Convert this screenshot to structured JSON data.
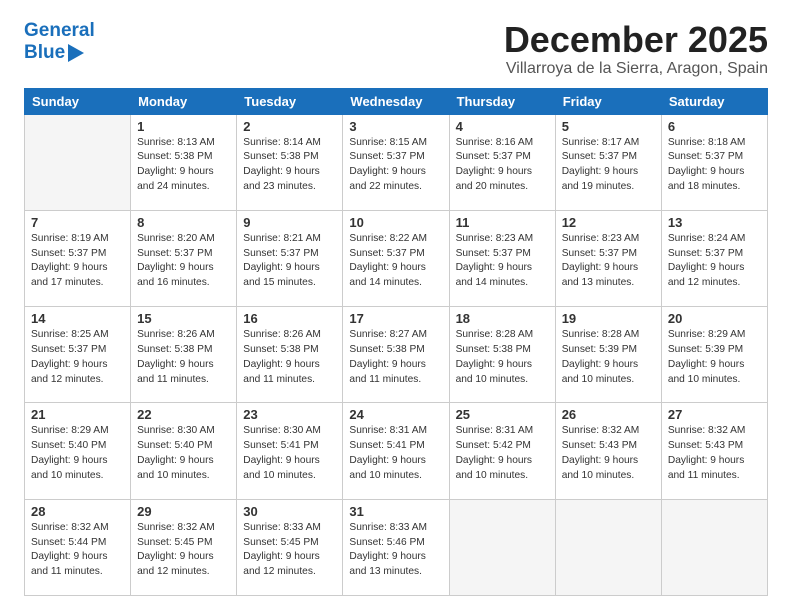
{
  "header": {
    "logo_line1": "General",
    "logo_line2": "Blue",
    "month_title": "December 2025",
    "location": "Villarroya de la Sierra, Aragon, Spain"
  },
  "weekdays": [
    "Sunday",
    "Monday",
    "Tuesday",
    "Wednesday",
    "Thursday",
    "Friday",
    "Saturday"
  ],
  "weeks": [
    [
      {
        "day": "",
        "info": ""
      },
      {
        "day": "1",
        "info": "Sunrise: 8:13 AM\nSunset: 5:38 PM\nDaylight: 9 hours\nand 24 minutes."
      },
      {
        "day": "2",
        "info": "Sunrise: 8:14 AM\nSunset: 5:38 PM\nDaylight: 9 hours\nand 23 minutes."
      },
      {
        "day": "3",
        "info": "Sunrise: 8:15 AM\nSunset: 5:37 PM\nDaylight: 9 hours\nand 22 minutes."
      },
      {
        "day": "4",
        "info": "Sunrise: 8:16 AM\nSunset: 5:37 PM\nDaylight: 9 hours\nand 20 minutes."
      },
      {
        "day": "5",
        "info": "Sunrise: 8:17 AM\nSunset: 5:37 PM\nDaylight: 9 hours\nand 19 minutes."
      },
      {
        "day": "6",
        "info": "Sunrise: 8:18 AM\nSunset: 5:37 PM\nDaylight: 9 hours\nand 18 minutes."
      }
    ],
    [
      {
        "day": "7",
        "info": "Sunrise: 8:19 AM\nSunset: 5:37 PM\nDaylight: 9 hours\nand 17 minutes."
      },
      {
        "day": "8",
        "info": "Sunrise: 8:20 AM\nSunset: 5:37 PM\nDaylight: 9 hours\nand 16 minutes."
      },
      {
        "day": "9",
        "info": "Sunrise: 8:21 AM\nSunset: 5:37 PM\nDaylight: 9 hours\nand 15 minutes."
      },
      {
        "day": "10",
        "info": "Sunrise: 8:22 AM\nSunset: 5:37 PM\nDaylight: 9 hours\nand 14 minutes."
      },
      {
        "day": "11",
        "info": "Sunrise: 8:23 AM\nSunset: 5:37 PM\nDaylight: 9 hours\nand 14 minutes."
      },
      {
        "day": "12",
        "info": "Sunrise: 8:23 AM\nSunset: 5:37 PM\nDaylight: 9 hours\nand 13 minutes."
      },
      {
        "day": "13",
        "info": "Sunrise: 8:24 AM\nSunset: 5:37 PM\nDaylight: 9 hours\nand 12 minutes."
      }
    ],
    [
      {
        "day": "14",
        "info": "Sunrise: 8:25 AM\nSunset: 5:37 PM\nDaylight: 9 hours\nand 12 minutes."
      },
      {
        "day": "15",
        "info": "Sunrise: 8:26 AM\nSunset: 5:38 PM\nDaylight: 9 hours\nand 11 minutes."
      },
      {
        "day": "16",
        "info": "Sunrise: 8:26 AM\nSunset: 5:38 PM\nDaylight: 9 hours\nand 11 minutes."
      },
      {
        "day": "17",
        "info": "Sunrise: 8:27 AM\nSunset: 5:38 PM\nDaylight: 9 hours\nand 11 minutes."
      },
      {
        "day": "18",
        "info": "Sunrise: 8:28 AM\nSunset: 5:38 PM\nDaylight: 9 hours\nand 10 minutes."
      },
      {
        "day": "19",
        "info": "Sunrise: 8:28 AM\nSunset: 5:39 PM\nDaylight: 9 hours\nand 10 minutes."
      },
      {
        "day": "20",
        "info": "Sunrise: 8:29 AM\nSunset: 5:39 PM\nDaylight: 9 hours\nand 10 minutes."
      }
    ],
    [
      {
        "day": "21",
        "info": "Sunrise: 8:29 AM\nSunset: 5:40 PM\nDaylight: 9 hours\nand 10 minutes."
      },
      {
        "day": "22",
        "info": "Sunrise: 8:30 AM\nSunset: 5:40 PM\nDaylight: 9 hours\nand 10 minutes."
      },
      {
        "day": "23",
        "info": "Sunrise: 8:30 AM\nSunset: 5:41 PM\nDaylight: 9 hours\nand 10 minutes."
      },
      {
        "day": "24",
        "info": "Sunrise: 8:31 AM\nSunset: 5:41 PM\nDaylight: 9 hours\nand 10 minutes."
      },
      {
        "day": "25",
        "info": "Sunrise: 8:31 AM\nSunset: 5:42 PM\nDaylight: 9 hours\nand 10 minutes."
      },
      {
        "day": "26",
        "info": "Sunrise: 8:32 AM\nSunset: 5:43 PM\nDaylight: 9 hours\nand 10 minutes."
      },
      {
        "day": "27",
        "info": "Sunrise: 8:32 AM\nSunset: 5:43 PM\nDaylight: 9 hours\nand 11 minutes."
      }
    ],
    [
      {
        "day": "28",
        "info": "Sunrise: 8:32 AM\nSunset: 5:44 PM\nDaylight: 9 hours\nand 11 minutes."
      },
      {
        "day": "29",
        "info": "Sunrise: 8:32 AM\nSunset: 5:45 PM\nDaylight: 9 hours\nand 12 minutes."
      },
      {
        "day": "30",
        "info": "Sunrise: 8:33 AM\nSunset: 5:45 PM\nDaylight: 9 hours\nand 12 minutes."
      },
      {
        "day": "31",
        "info": "Sunrise: 8:33 AM\nSunset: 5:46 PM\nDaylight: 9 hours\nand 13 minutes."
      },
      {
        "day": "",
        "info": ""
      },
      {
        "day": "",
        "info": ""
      },
      {
        "day": "",
        "info": ""
      }
    ]
  ]
}
